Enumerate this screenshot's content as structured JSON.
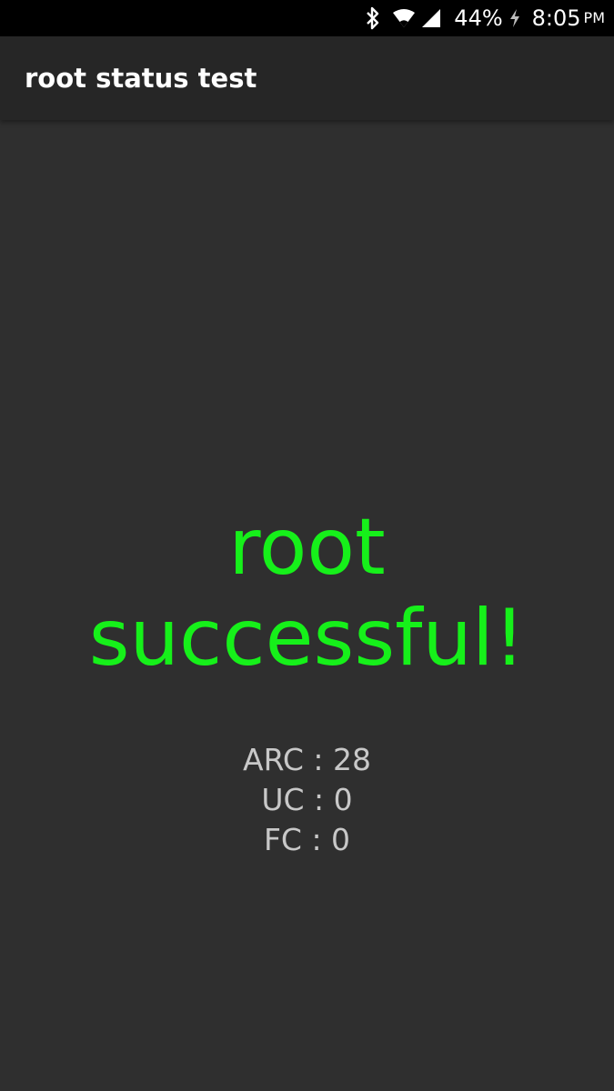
{
  "status_bar": {
    "battery_percent": "44%",
    "time": "8:05",
    "ampm": "PM",
    "icons": [
      "bluetooth-icon",
      "wifi-icon",
      "cell-signal-icon",
      "charging-icon"
    ]
  },
  "app_bar": {
    "title": "root status test"
  },
  "main": {
    "result_message": "root\nsuccessful!",
    "counters": [
      {
        "label": "ARC",
        "value": "28",
        "text": "ARC : 28"
      },
      {
        "label": "UC",
        "value": "0",
        "text": "UC : 0"
      },
      {
        "label": "FC",
        "value": "0",
        "text": "FC : 0"
      }
    ]
  },
  "colors": {
    "background": "#2f2f2f",
    "app_bar": "#262626",
    "status_bar": "#000000",
    "success": "#16f01a",
    "counter_text": "#c8c8c8"
  }
}
